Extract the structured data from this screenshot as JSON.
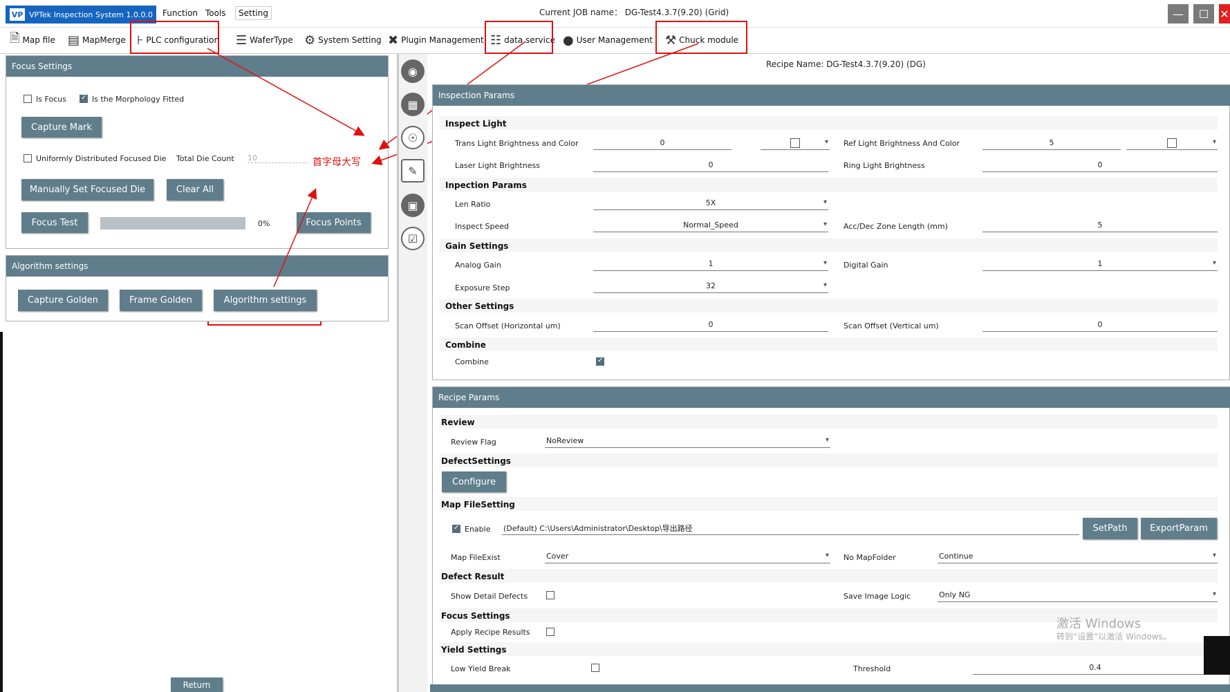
{
  "app": {
    "title": "VPTek Inspection System 1.0.0.0",
    "logo_text": "VP",
    "menus": [
      "Function",
      "Tools",
      "Setting"
    ],
    "job_name": "Current JOB name： DG-Test4.3.7(9.20) (Grid)",
    "window_buttons": {
      "minimize": "—",
      "maximize": "☐",
      "close": "✕"
    }
  },
  "toolbar": {
    "items": [
      {
        "label": "Map file",
        "icon": "file-icon"
      },
      {
        "label": "MapMerge",
        "icon": "merge-icon"
      },
      {
        "label": "PLC configuration",
        "icon": "plc-icon"
      },
      {
        "label": "WaferType",
        "icon": "list-icon"
      },
      {
        "label": "System Setting",
        "icon": "gear-icon"
      },
      {
        "label": "Plugin Management",
        "icon": "tools-icon"
      },
      {
        "label": "data service",
        "icon": "database-icon"
      },
      {
        "label": "User Management",
        "icon": "user-icon"
      },
      {
        "label": "Chuck module",
        "icon": "wrench-icon"
      }
    ]
  },
  "focus_settings": {
    "header": "Focus Settings",
    "is_focus": {
      "label": "Is Focus",
      "checked": false
    },
    "morphology": {
      "label": "Is the Morphology Fitted",
      "checked": true
    },
    "capture_mark": "Capture Mark",
    "uniform": {
      "label": "Uniformly Distributed Focused Die",
      "checked": false
    },
    "total_die_label": "Total Die Count",
    "total_die_value": "10",
    "manual_set": "Manually Set Focused Die",
    "clear_all": "Clear All",
    "focus_test": "Focus Test",
    "progress": 0,
    "progress_text": "0%",
    "focus_points": "Focus Points"
  },
  "algorithm_settings": {
    "header": "Algorithm settings",
    "capture_golden": "Capture Golden",
    "frame_golden": "Frame Golden",
    "algorithm_button": "Algorithm settings"
  },
  "return_button": "Return",
  "annotation": "首字母大写",
  "recipe_name": "Recipe Name: DG-Test4.3.7(9.20) (DG)",
  "inspection": {
    "header": "Inspection Params",
    "inspect_light": "Inspect Light",
    "trans_label": "Trans Light Brightness and Color",
    "trans_value": "0",
    "ref_label": "Ref Light Brightness And Color",
    "ref_value": "5",
    "laser_label": "Laser Light Brightness",
    "laser_value": "0",
    "ring_label": "Ring Light Brightness",
    "ring_value": "0",
    "inspection_params": "Inpection Params",
    "len_label": "Len Ratio",
    "len_value": "5X",
    "speed_label": "Inspect Speed",
    "speed_value": "Normal_Speed",
    "acc_label": "Acc/Dec Zone Length (mm)",
    "acc_value": "5",
    "gain_settings": "Gain Settings",
    "analog_label": "Analog Gain",
    "analog_value": "1",
    "digital_label": "Digital Gain",
    "digital_value": "1",
    "exposure_label": "Exposure Step",
    "exposure_value": "32",
    "other_settings": "Other Settings",
    "scan_h_label": "Scan Offset (Horizontal um)",
    "scan_h_value": "0",
    "scan_v_label": "Scan Offset (Vertical um)",
    "scan_v_value": "0",
    "combine_section": "Combine",
    "combine_label": "Combine",
    "combine_checked": true
  },
  "recipe": {
    "header": "Recipe Params",
    "review": "Review",
    "review_flag_label": "Review Flag",
    "review_flag_value": "NoReview",
    "defect_settings": "DefectSettings",
    "configure": "Configure",
    "map_filesetting": "Map FileSetting",
    "enable_label": "Enable",
    "enable_checked": true,
    "path_value": "(Default) C:\\Users\\Administrator\\Desktop\\导出路径",
    "setpath": "SetPath",
    "exportparam": "ExportParam",
    "map_fileexist_label": "Map FileExist",
    "map_fileexist_value": "Cover",
    "no_mapfolder_label": "No MapFolder",
    "no_mapfolder_value": "Continue",
    "defect_result": "Defect Result",
    "show_detail_label": "Show Detail Defects",
    "save_image_label": "Save Image Logic",
    "save_image_value": "Only NG",
    "focus_settings": "Focus Settings",
    "apply_recipe_label": "Apply Recipe Results",
    "yield_settings": "Yield Settings",
    "low_yield_label": "Low Yield Break",
    "threshold_label": "Threshold",
    "threshold_value": "0.4"
  },
  "watermark": {
    "line1": "激活 Windows",
    "line2": "转到“设置”以激活 Windows。"
  },
  "colors": {
    "header": "#607d8b",
    "annotation": "#e01010",
    "title_blue": "#1565c0"
  }
}
